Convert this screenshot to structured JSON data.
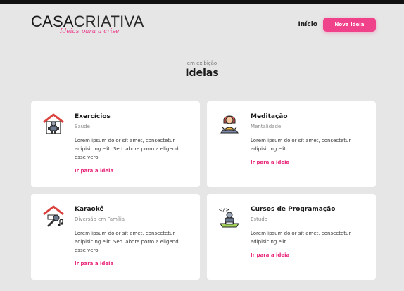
{
  "header": {
    "logo_part1": "CASA",
    "logo_part2": "CRIATIVA",
    "tagline": "Ideias para a crise",
    "nav_home": "Início",
    "new_idea_button": "Nova Ideia"
  },
  "section": {
    "eyebrow": "em exibição",
    "title": "Ideias"
  },
  "cards": [
    {
      "title": "Exercícios",
      "category": "Saúde",
      "description": "Lorem ipsum dolor sit amet, consectetur adipisicing elit. Sed labore porro a eligendi esse vero",
      "link": "Ir para a ideia",
      "icon": "home-workout-icon"
    },
    {
      "title": "Meditação",
      "category": "Mentalidade",
      "description": "Lorem ipsum dolor sit amet, consectetur adipisicing elit.",
      "link": "Ir para a ideia",
      "icon": "meditation-icon"
    },
    {
      "title": "Karaokê",
      "category": "Diversão em Família",
      "description": "Lorem ipsum dolor sit amet, consectetur adipisicing elit. Sed labore porro a eligendi esse vero",
      "link": "Ir para a ideia",
      "icon": "karaoke-icon"
    },
    {
      "title": "Cursos de Programação",
      "category": "Estudo",
      "description": "Lorem ipsum dolor sit amet, consectetur adipisicing elit.",
      "link": "Ir para a ideia",
      "icon": "programming-icon"
    }
  ],
  "colors": {
    "accent": "#f0428b",
    "link": "#e8267a",
    "background": "#e6e6e6"
  }
}
